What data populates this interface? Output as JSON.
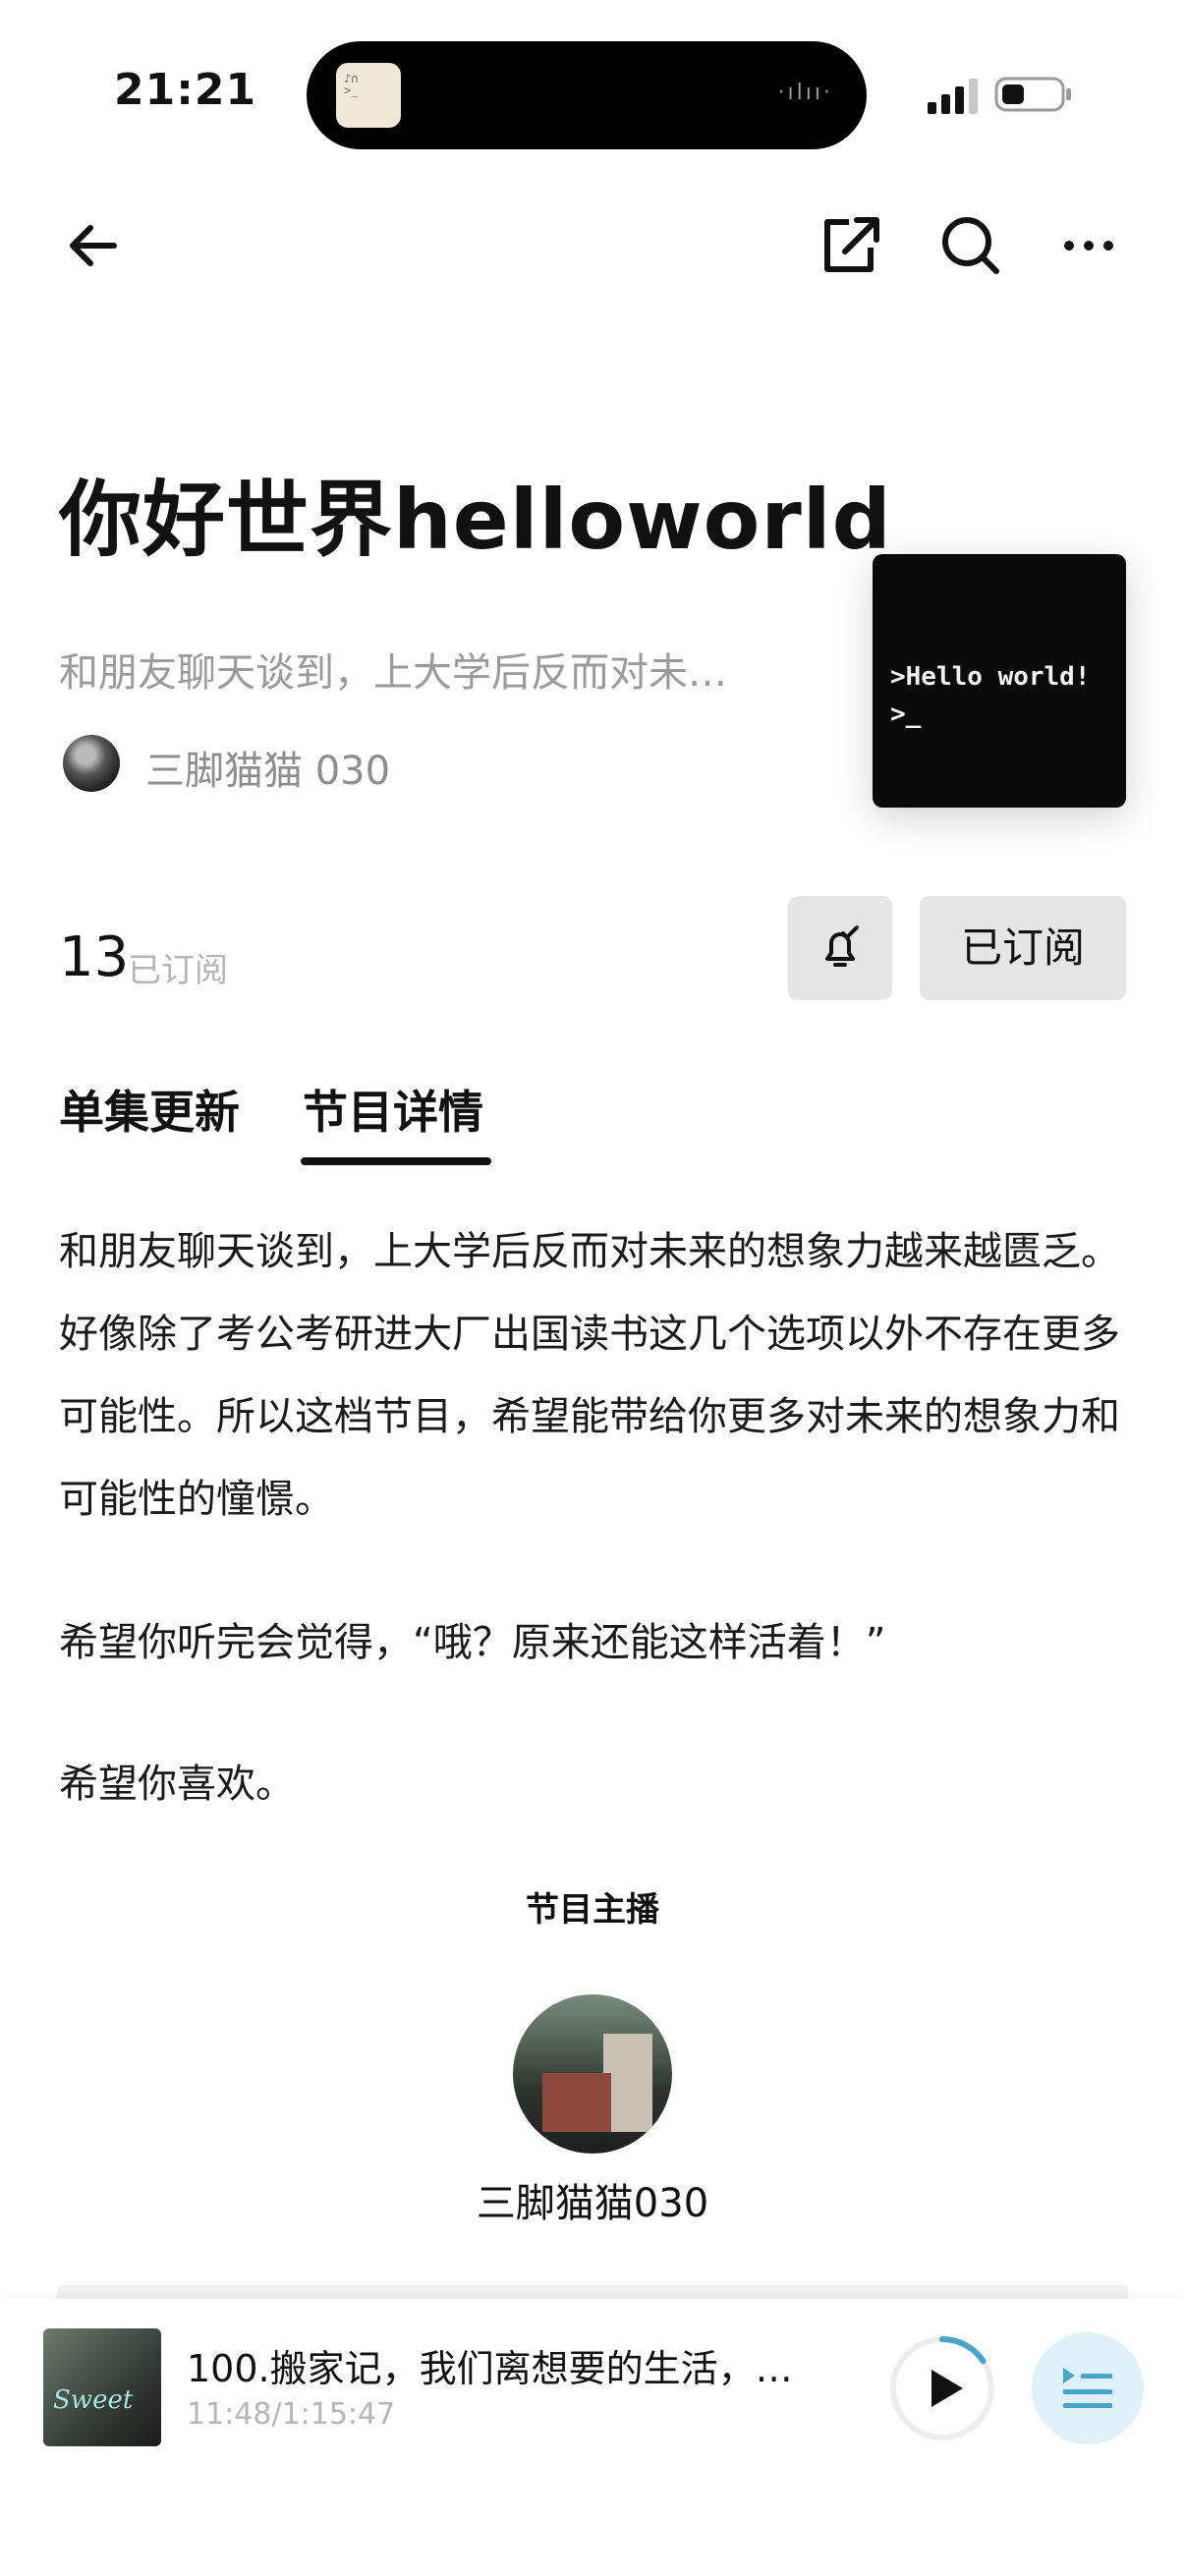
{
  "status_bar": {
    "time": "21:21"
  },
  "podcast": {
    "title": "你好世界helloworld",
    "short_description": "和朋友聊天谈到，上大学后反而对未…",
    "host_name": "三脚猫猫 030",
    "cover_lines": [
      ">Hello world!",
      ">_"
    ],
    "subscriber_count": "13",
    "subscriber_label": "已订阅",
    "subscribe_button": "已订阅"
  },
  "tabs": [
    {
      "label": "单集更新",
      "active": false
    },
    {
      "label": "节目详情",
      "active": true
    }
  ],
  "details": {
    "paragraph1": "和朋友聊天谈到，上大学后反而对未来的想象力越来越匮乏。好像除了考公考研进大厂出国读书这几个选项以外不存在更多可能性。所以这档节目，希望能带给你更多对未来的想象力和可能性的憧憬。",
    "paragraph2": "希望你听完会觉得，“哦？原来还能这样活着！”",
    "paragraph3": "希望你喜欢。",
    "host_section_title": "节目主播",
    "host_name": "三脚猫猫030"
  },
  "player": {
    "episode_title": "100.搬家记，我们离想要的生活，好…",
    "time": "11:48/1:15:47",
    "thumb_text": "Sweet",
    "progress": 0.156
  },
  "colors": {
    "accent": "#4aa3c8",
    "tab_underline": "#111111"
  }
}
